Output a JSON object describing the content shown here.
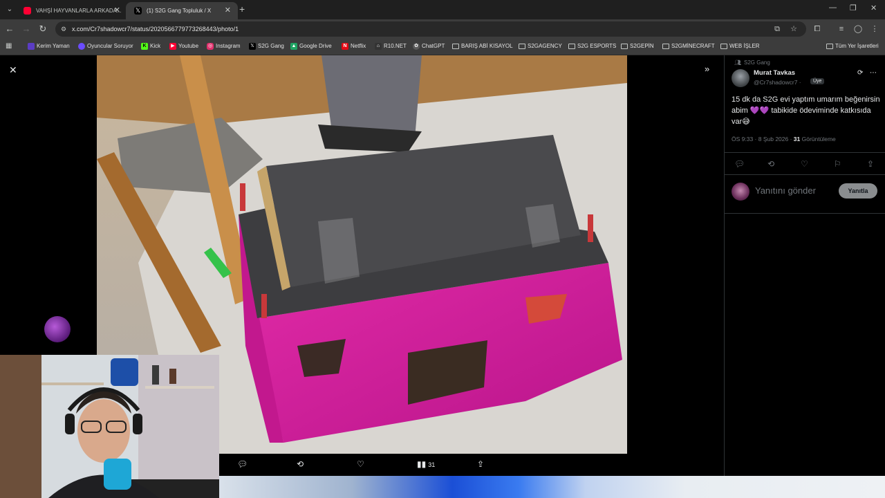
{
  "tabs": [
    {
      "label": "VAHŞİ HAYVANLARLA ARKADA...",
      "active": false,
      "favicon_color": "#ff0033"
    },
    {
      "label": "(1) S2G Gang Topluluk / X",
      "active": true,
      "favicon_color": "#000000"
    }
  ],
  "toolbar": {
    "url": "x.com/Cr7shadowcr7/status/2020566779773268443/photo/1"
  },
  "bookmarks": [
    {
      "label": "Kerim Yaman",
      "icon": "person-icon",
      "color": "#5b3cc4"
    },
    {
      "label": "Oyuncular Soruyor",
      "icon": "circle-icon",
      "color": "#6b4cff"
    },
    {
      "label": "Kick",
      "icon": "kick-icon",
      "color": "#53fc18"
    },
    {
      "label": "Youtube",
      "icon": "youtube-icon",
      "color": "#ff0033"
    },
    {
      "label": "Instagram",
      "icon": "instagram-icon",
      "color": "#e1306c"
    },
    {
      "label": "S2G Gang",
      "icon": "x-icon",
      "color": "#000000"
    },
    {
      "label": "Google Drive",
      "icon": "drive-icon",
      "color": "#1fa463"
    },
    {
      "label": "Netflix",
      "icon": "netflix-icon",
      "color": "#e50914"
    },
    {
      "label": "R10.NET",
      "icon": "r10-icon",
      "color": "#333333"
    },
    {
      "label": "ChatGPT",
      "icon": "chatgpt-icon",
      "color": "#5a5a5a"
    },
    {
      "label": "BARIŞ ABİ KISAYOL",
      "icon": "folder-icon",
      "color": ""
    },
    {
      "label": "S2GAGENCY",
      "icon": "folder-icon",
      "color": ""
    },
    {
      "label": "S2G ESPORTS",
      "icon": "folder-icon",
      "color": ""
    },
    {
      "label": "S2GEPİN",
      "icon": "folder-icon",
      "color": ""
    },
    {
      "label": "S2GMİNECRAFT",
      "icon": "folder-icon",
      "color": ""
    },
    {
      "label": "WEB İŞLER",
      "icon": "folder-icon",
      "color": ""
    }
  ],
  "all_bookmarks_label": "Tüm Yer İşaretleri",
  "mediabar": {
    "views": "31"
  },
  "tweet": {
    "community": "S2G Gang",
    "author": "Murat Tavkas",
    "handle": "@Cr7shadowcr7 ·",
    "role": "Üye",
    "text": "15 dk da S2G evi yaptım umarım beğenirsin abim 💜💜 tabikide ödeviminde katkısıda var😅",
    "time": "ÖS 9:33 · 8 Şub 2026 · ",
    "views_count": "31",
    "views_label": " Görüntüleme",
    "reply_placeholder": "Yanıtını gönder",
    "reply_button": "Yanıtla"
  },
  "colors": {
    "background": "#000000",
    "border": "#2f3336",
    "secondary_text": "#71767b",
    "house_pink": "#d61f9e",
    "roof_gray": "#4a4a4d"
  }
}
